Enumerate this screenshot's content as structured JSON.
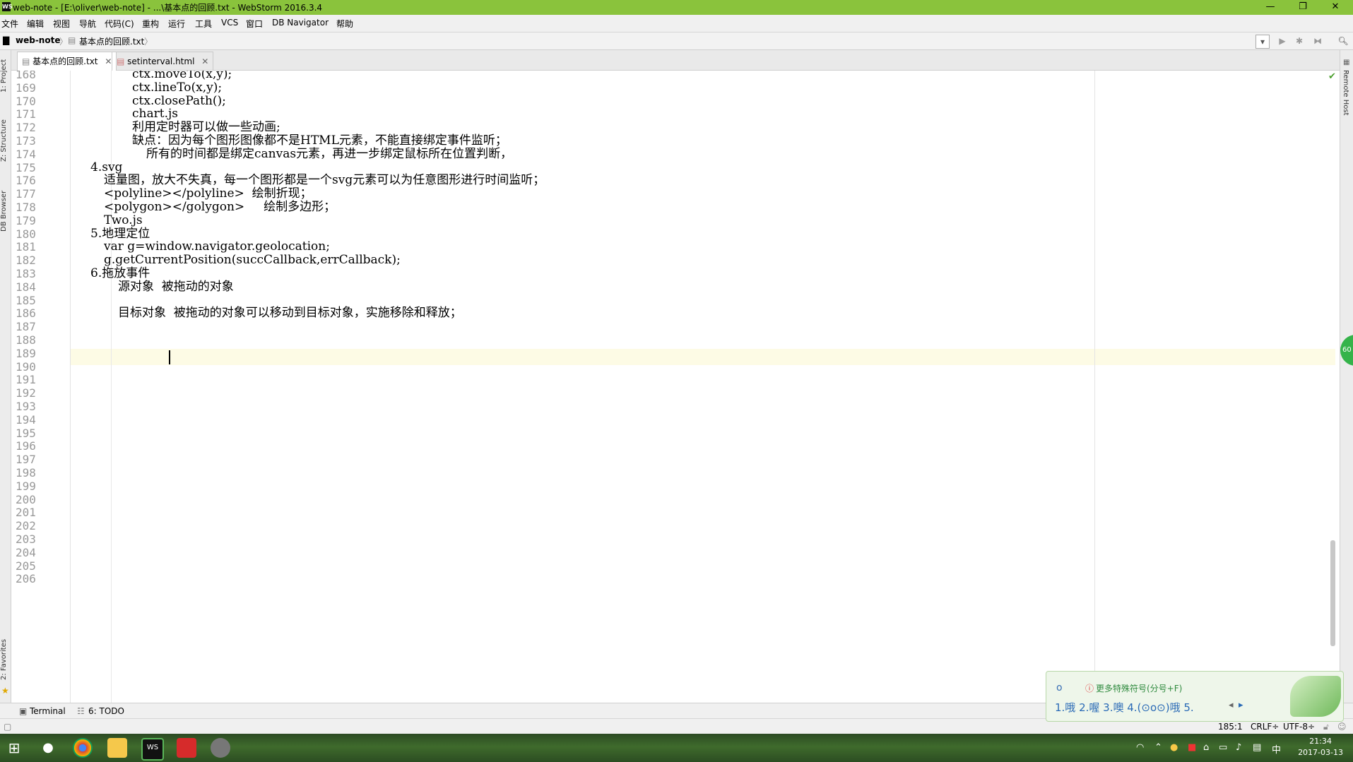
{
  "window": {
    "title": "web-note - [E:\\oliver\\web-note] - ...\\基本点的回顾.txt - WebStorm 2016.3.4",
    "logo": "WS",
    "minimize_icon": "minimize-icon",
    "restore_icon": "restore-icon",
    "close_icon": "close-icon",
    "title_bar_color": "#8ac33c"
  },
  "menu": [
    "文件",
    "编辑",
    "视图",
    "导航",
    "代码(C)",
    "重构",
    "运行",
    "工具",
    "VCS",
    "窗口",
    "DB Navigator",
    "帮助"
  ],
  "breadcrumb": {
    "project": "web-note",
    "file": "基本点的回顾.txt"
  },
  "tabs": [
    {
      "label": "基本点的回顾.txt",
      "active": true
    },
    {
      "label": "setinterval.html",
      "active": false
    }
  ],
  "left_tools": [
    "1: Project",
    "Z: Structure",
    "DB Browser",
    "2: Favorites"
  ],
  "right_tools": [
    "Remote Host"
  ],
  "editor": {
    "current_line": "185",
    "lines": [
      {
        "num": "168",
        "text": "ctx.moveTo(x,y);"
      },
      {
        "num": "169",
        "text": "ctx.lineTo(x,y);"
      },
      {
        "num": "170",
        "text": "ctx.closePath();"
      },
      {
        "num": "171",
        "text": "chart.js"
      },
      {
        "num": "172",
        "text": "利用定时器可以做一些动画;"
      },
      {
        "num": "173",
        "text": "缺点：因为每个图形图像都不是HTML元素，不能直接绑定事件监听；"
      },
      {
        "num": "174",
        "text": "所有的时间都是绑定canvas元素，再进一步绑定鼠标所在位置判断，"
      },
      {
        "num": "175",
        "text": "4.svg"
      },
      {
        "num": "176",
        "text": "适量图，放大不失真，每一个图形都是一个svg元素可以为任意图形进行时间监听；"
      },
      {
        "num": "177",
        "text": "<polyline></polyline>  绘制折现；"
      },
      {
        "num": "178",
        "text": "<polygon></golygon>     绘制多边形；"
      },
      {
        "num": "179",
        "text": "Two.js"
      },
      {
        "num": "180",
        "text": "5.地理定位"
      },
      {
        "num": "181",
        "text": "var g=window.navigator.geolocation;"
      },
      {
        "num": "182",
        "text": "g.getCurrentPosition(succCallback,errCallback);"
      },
      {
        "num": "183",
        "text": "6.拖放事件"
      },
      {
        "num": "184",
        "text": "源对象  被拖动的对象"
      },
      {
        "num": "185",
        "text": ""
      },
      {
        "num": "186",
        "text": "目标对象  被拖动的对象可以移动到目标对象，实施移除和释放；"
      },
      {
        "num": "187",
        "text": ""
      },
      {
        "num": "188",
        "text": ""
      },
      {
        "num": "189",
        "text": ""
      },
      {
        "num": "190",
        "text": ""
      },
      {
        "num": "191",
        "text": ""
      },
      {
        "num": "192",
        "text": ""
      },
      {
        "num": "193",
        "text": ""
      },
      {
        "num": "194",
        "text": ""
      },
      {
        "num": "195",
        "text": ""
      },
      {
        "num": "196",
        "text": ""
      },
      {
        "num": "197",
        "text": ""
      },
      {
        "num": "198",
        "text": ""
      },
      {
        "num": "199",
        "text": ""
      },
      {
        "num": "200",
        "text": ""
      },
      {
        "num": "201",
        "text": ""
      },
      {
        "num": "202",
        "text": ""
      },
      {
        "num": "203",
        "text": ""
      },
      {
        "num": "204",
        "text": ""
      },
      {
        "num": "205",
        "text": ""
      },
      {
        "num": "206",
        "text": ""
      }
    ]
  },
  "bottom_tools": {
    "terminal": "Terminal",
    "todo": "6: TODO"
  },
  "status": {
    "position": "185:1",
    "line_sep": "CRLF÷",
    "encoding": "UTF-8÷"
  },
  "ime": {
    "composition": "o",
    "hint": "更多特殊符号(分号+F)",
    "candidates": "1.哦  2.喔  3.噢  4.(⊙o⊙)哦  5.",
    "side_badge": "60"
  },
  "taskbar": {
    "time": "21:34",
    "date": "2017-03-13",
    "ime_mode": "中"
  }
}
